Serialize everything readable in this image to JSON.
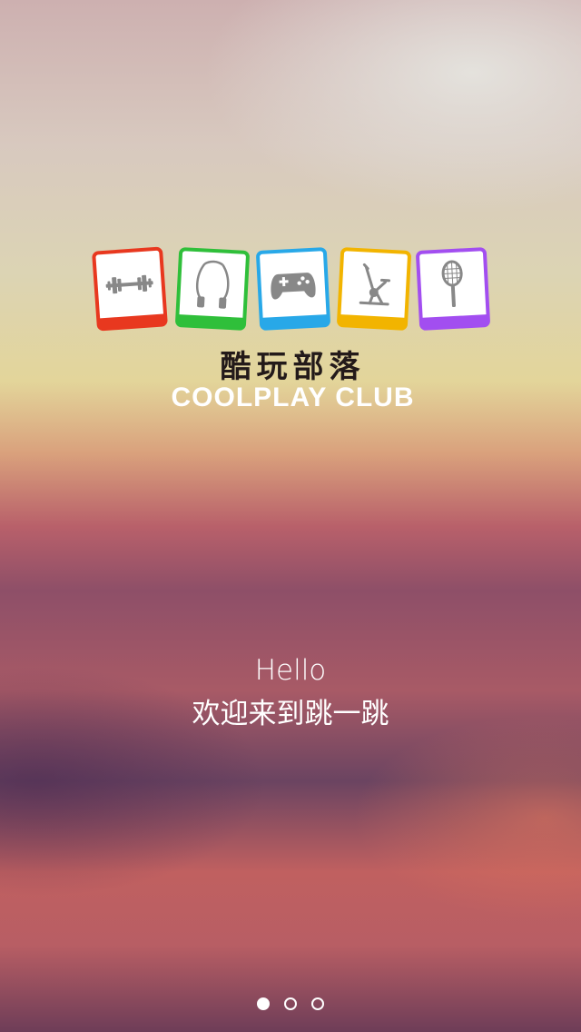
{
  "logo": {
    "cn_name": "酷玩部落",
    "en_name": "COOLPLAY CLUB",
    "tiles": [
      {
        "icon": "dumbbell-icon",
        "color": "#e8381f"
      },
      {
        "icon": "jump-rope-icon",
        "color": "#2fbf3a"
      },
      {
        "icon": "gamepad-icon",
        "color": "#28a8e8"
      },
      {
        "icon": "exercise-bike-icon",
        "color": "#f2b400"
      },
      {
        "icon": "tennis-racket-icon",
        "color": "#a24ef0"
      }
    ]
  },
  "greeting": {
    "hello": "Hello",
    "welcome": "欢迎来到跳一跳"
  },
  "pagination": {
    "total": 3,
    "current": 1
  }
}
